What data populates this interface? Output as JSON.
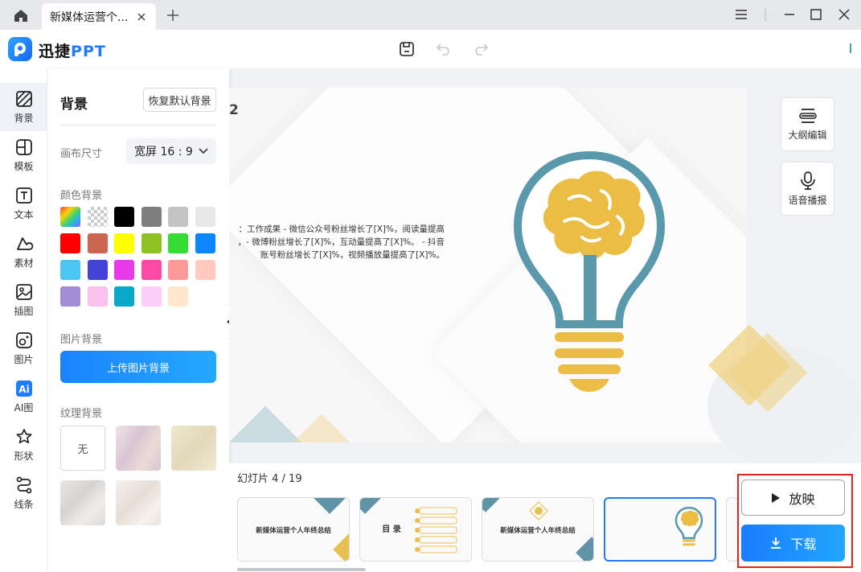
{
  "titlebar": {
    "tab_title": "新媒体运营个...",
    "colors": {
      "bar": "#e6e8ec",
      "tab": "#ffffff"
    }
  },
  "app": {
    "brand_prefix": "迅捷",
    "brand_suffix": "PPT",
    "brand_color": "#1f7bff"
  },
  "iconbar": {
    "items": [
      {
        "label": "背景",
        "icon": "background-icon"
      },
      {
        "label": "模板",
        "icon": "template-icon"
      },
      {
        "label": "文本",
        "icon": "text-icon"
      },
      {
        "label": "素材",
        "icon": "material-icon"
      },
      {
        "label": "插图",
        "icon": "illustration-icon"
      },
      {
        "label": "图片",
        "icon": "image-icon"
      },
      {
        "label": "AI图",
        "icon": "ai-image-icon"
      },
      {
        "label": "形状",
        "icon": "shape-icon"
      },
      {
        "label": "线条",
        "icon": "line-icon"
      }
    ]
  },
  "panel": {
    "title": "背景",
    "reset_label": "恢复默认背景",
    "canvas_size_label": "画布尺寸",
    "canvas_size_value": "宽屏 16 : 9",
    "color_bg_label": "颜色背景",
    "colors": [
      "gradient",
      "transparent",
      "#000000",
      "#7f7f7f",
      "#c4c4c4",
      "#e8e8e8",
      "#ff0000",
      "#cc6650",
      "#ffff00",
      "#8dc124",
      "#33dd33",
      "#0b86ff",
      "#4cc6f3",
      "#4343d8",
      "#e93ae9",
      "#ff4aa5",
      "#ff9a9a",
      "#ffcbc0",
      "#a38bd7",
      "#fbc1ec",
      "#0aa9cc",
      "#fdcdf9",
      "#fee7cd"
    ],
    "image_bg_label": "图片背景",
    "upload_label": "上传图片背景",
    "texture_bg_label": "纹理背景",
    "texture_none_label": "无",
    "textures": [
      "#e5d6dd",
      "#e9dfc6",
      "#e7e5e3",
      "#efeae5"
    ]
  },
  "slide": {
    "number": "2",
    "lines": [
      "：工作成果 - 微信公众号粉丝增长了[X]%，阅读量提高",
      "，- 微博粉丝增长了[X]%，互动量提高了[X]%。 - 抖音",
      "账号粉丝增长了[X]%，视频播放量提高了[X]%。"
    ]
  },
  "right_tools": {
    "outline_label": "大纲编辑",
    "voice_label": "语音播报"
  },
  "bottom": {
    "counter": "幻灯片 4 / 19",
    "thumbs": [
      {
        "title": "新媒体运营个人年终总结"
      },
      {
        "title": "目 录"
      },
      {
        "title": "新媒体运营个人年终总结"
      },
      {
        "title": ""
      }
    ],
    "play_label": "放映",
    "download_label": "下载"
  }
}
